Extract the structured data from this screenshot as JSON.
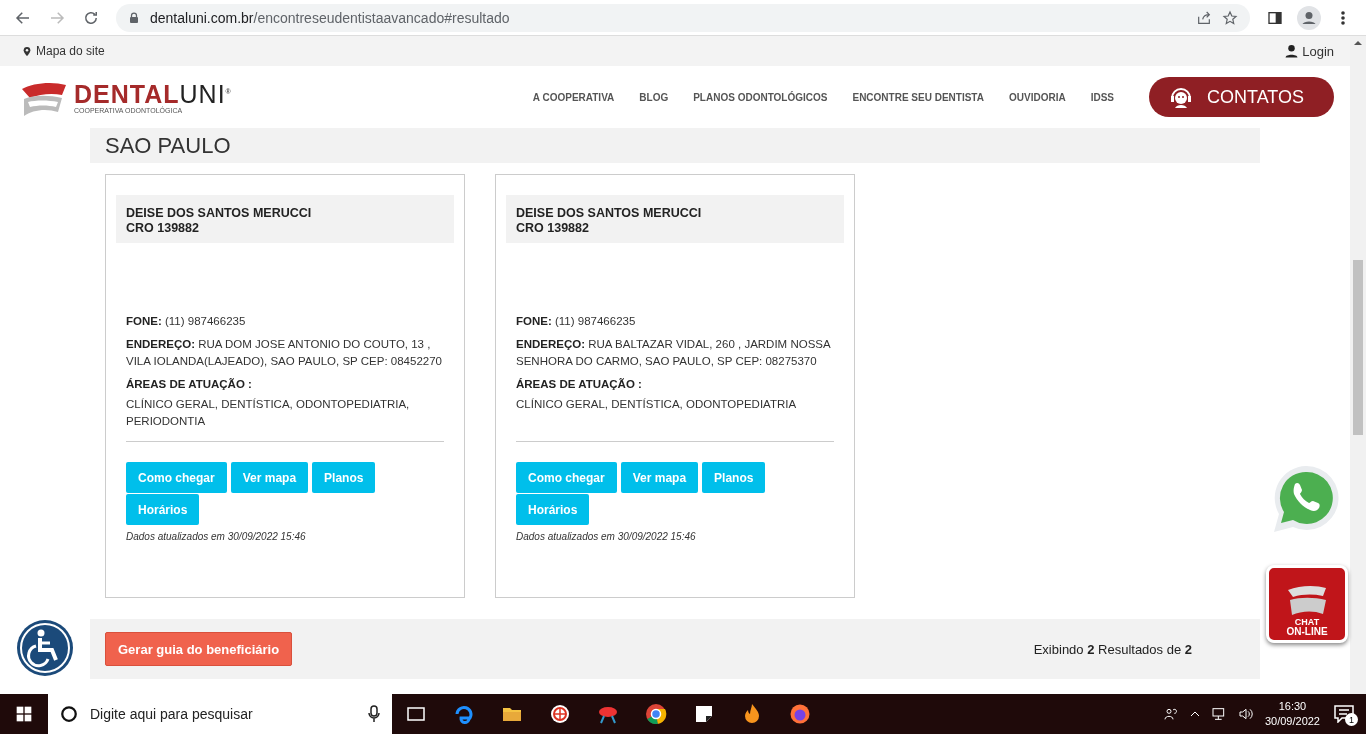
{
  "browser": {
    "url_domain": "dentaluni.com.br",
    "url_path": "/encontreseudentistaavancado#resultado"
  },
  "topbar": {
    "sitemap": "Mapa do site",
    "login": "Login"
  },
  "logo": {
    "name_a": "DENTAL",
    "name_b": "UNI",
    "mark": "®",
    "tagline": "COOPERATIVA ODONTOLÓGICA"
  },
  "nav": [
    "A COOPERATIVA",
    "BLOG",
    "PLANOS ODONTOLÓGICOS",
    "ENCONTRE SEU DENTISTA",
    "OUVIDORIA",
    "IDSS"
  ],
  "contacts_button": "CONTATOS",
  "section_title": "SAO PAULO",
  "dentists": [
    {
      "name": "DEISE DOS SANTOS MERUCCI",
      "cro": "CRO 139882",
      "phone_label": "FONE:",
      "phone": "(11) 987466235",
      "address_label": "ENDEREÇO:",
      "address": "RUA DOM JOSE ANTONIO DO COUTO, 13 , VILA IOLANDA(LAJEADO), SAO PAULO, SP CEP: 08452270",
      "areas_label": "ÁREAS DE ATUAÇÃO :",
      "areas": "CLÍNICO GERAL, DENTÍSTICA, ODONTOPEDIATRIA, PERIODONTIA",
      "buttons": [
        "Como chegar",
        "Ver mapa",
        "Planos",
        "Horários"
      ],
      "updated": "Dados atualizados em 30/09/2022 15:46"
    },
    {
      "name": "DEISE DOS SANTOS MERUCCI",
      "cro": "CRO 139882",
      "phone_label": "FONE:",
      "phone": "(11) 987466235",
      "address_label": "ENDEREÇO:",
      "address": "RUA BALTAZAR VIDAL, 260 , JARDIM NOSSA SENHORA DO CARMO, SAO PAULO, SP CEP: 08275370",
      "areas_label": "ÁREAS DE ATUAÇÃO :",
      "areas": "CLÍNICO GERAL, DENTÍSTICA, ODONTOPEDIATRIA",
      "buttons": [
        "Como chegar",
        "Ver mapa",
        "Planos",
        "Horários"
      ],
      "updated": "Dados atualizados em 30/09/2022 15:46"
    }
  ],
  "footer": {
    "button": "Gerar guia do beneficiário",
    "results": "Exibindo **2** Resultados de **2**"
  },
  "chat_badge": {
    "line1": "CHAT",
    "line2": "ON-LINE"
  },
  "taskbar": {
    "search_placeholder": "Digite aqui para pesquisar",
    "time": "16:30",
    "date": "30/09/2022",
    "notifications": "1"
  }
}
